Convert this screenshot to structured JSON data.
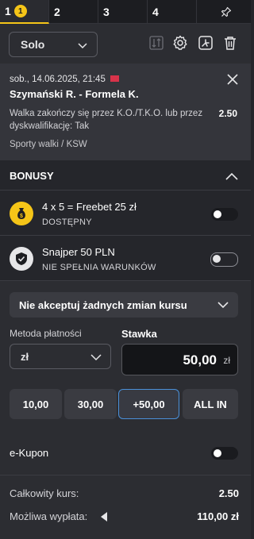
{
  "tabs": [
    {
      "label": "1",
      "badge": "1",
      "active": true
    },
    {
      "label": "2"
    },
    {
      "label": "3"
    },
    {
      "label": "4"
    }
  ],
  "toolbar": {
    "bet_type": "Solo",
    "icons": [
      "sort-icon",
      "settings-gear-icon",
      "share-icon",
      "trash-icon"
    ]
  },
  "bet": {
    "datetime": "sob., 14.06.2025, 21:45",
    "event": "Szymański R. - Formela K.",
    "selection": "Walka zakończy się przez K.O./T.K.O. lub przez dyskwalifikację: Tak",
    "odds": "2.50",
    "category": "Sporty walki / KSW"
  },
  "bonus": {
    "header": "BONUSY",
    "items": [
      {
        "title": "4 x 5 = Freebet 25 zł",
        "status": "DOSTĘPNY",
        "icon": "money-bag-icon",
        "enabled": false
      },
      {
        "title": "Snajper 50 PLN",
        "status": "NIE SPEŁNIA WARUNKÓW",
        "icon": "shield-icon",
        "enabled": false
      }
    ]
  },
  "odds_change": {
    "selected": "Nie akceptuj żadnych zmian kursu"
  },
  "payment": {
    "label": "Metoda płatności",
    "selected": "zł"
  },
  "stake": {
    "label": "Stawka",
    "value": "50,00",
    "currency": "zł"
  },
  "quick_stakes": [
    {
      "label": "10,00"
    },
    {
      "label": "30,00"
    },
    {
      "label": "+50,00",
      "active": true
    },
    {
      "label": "ALL IN"
    }
  ],
  "ekupon": {
    "label": "e-Kupon",
    "enabled": false
  },
  "summary": {
    "total_odds_label": "Całkowity kurs:",
    "total_odds_value": "2.50",
    "payout_label": "Możliwa wypłata:",
    "payout_value": "110,00 zł"
  },
  "colors": {
    "accent": "#f5c518",
    "active_border": "#4a90d9",
    "flag": "#d8334a"
  }
}
